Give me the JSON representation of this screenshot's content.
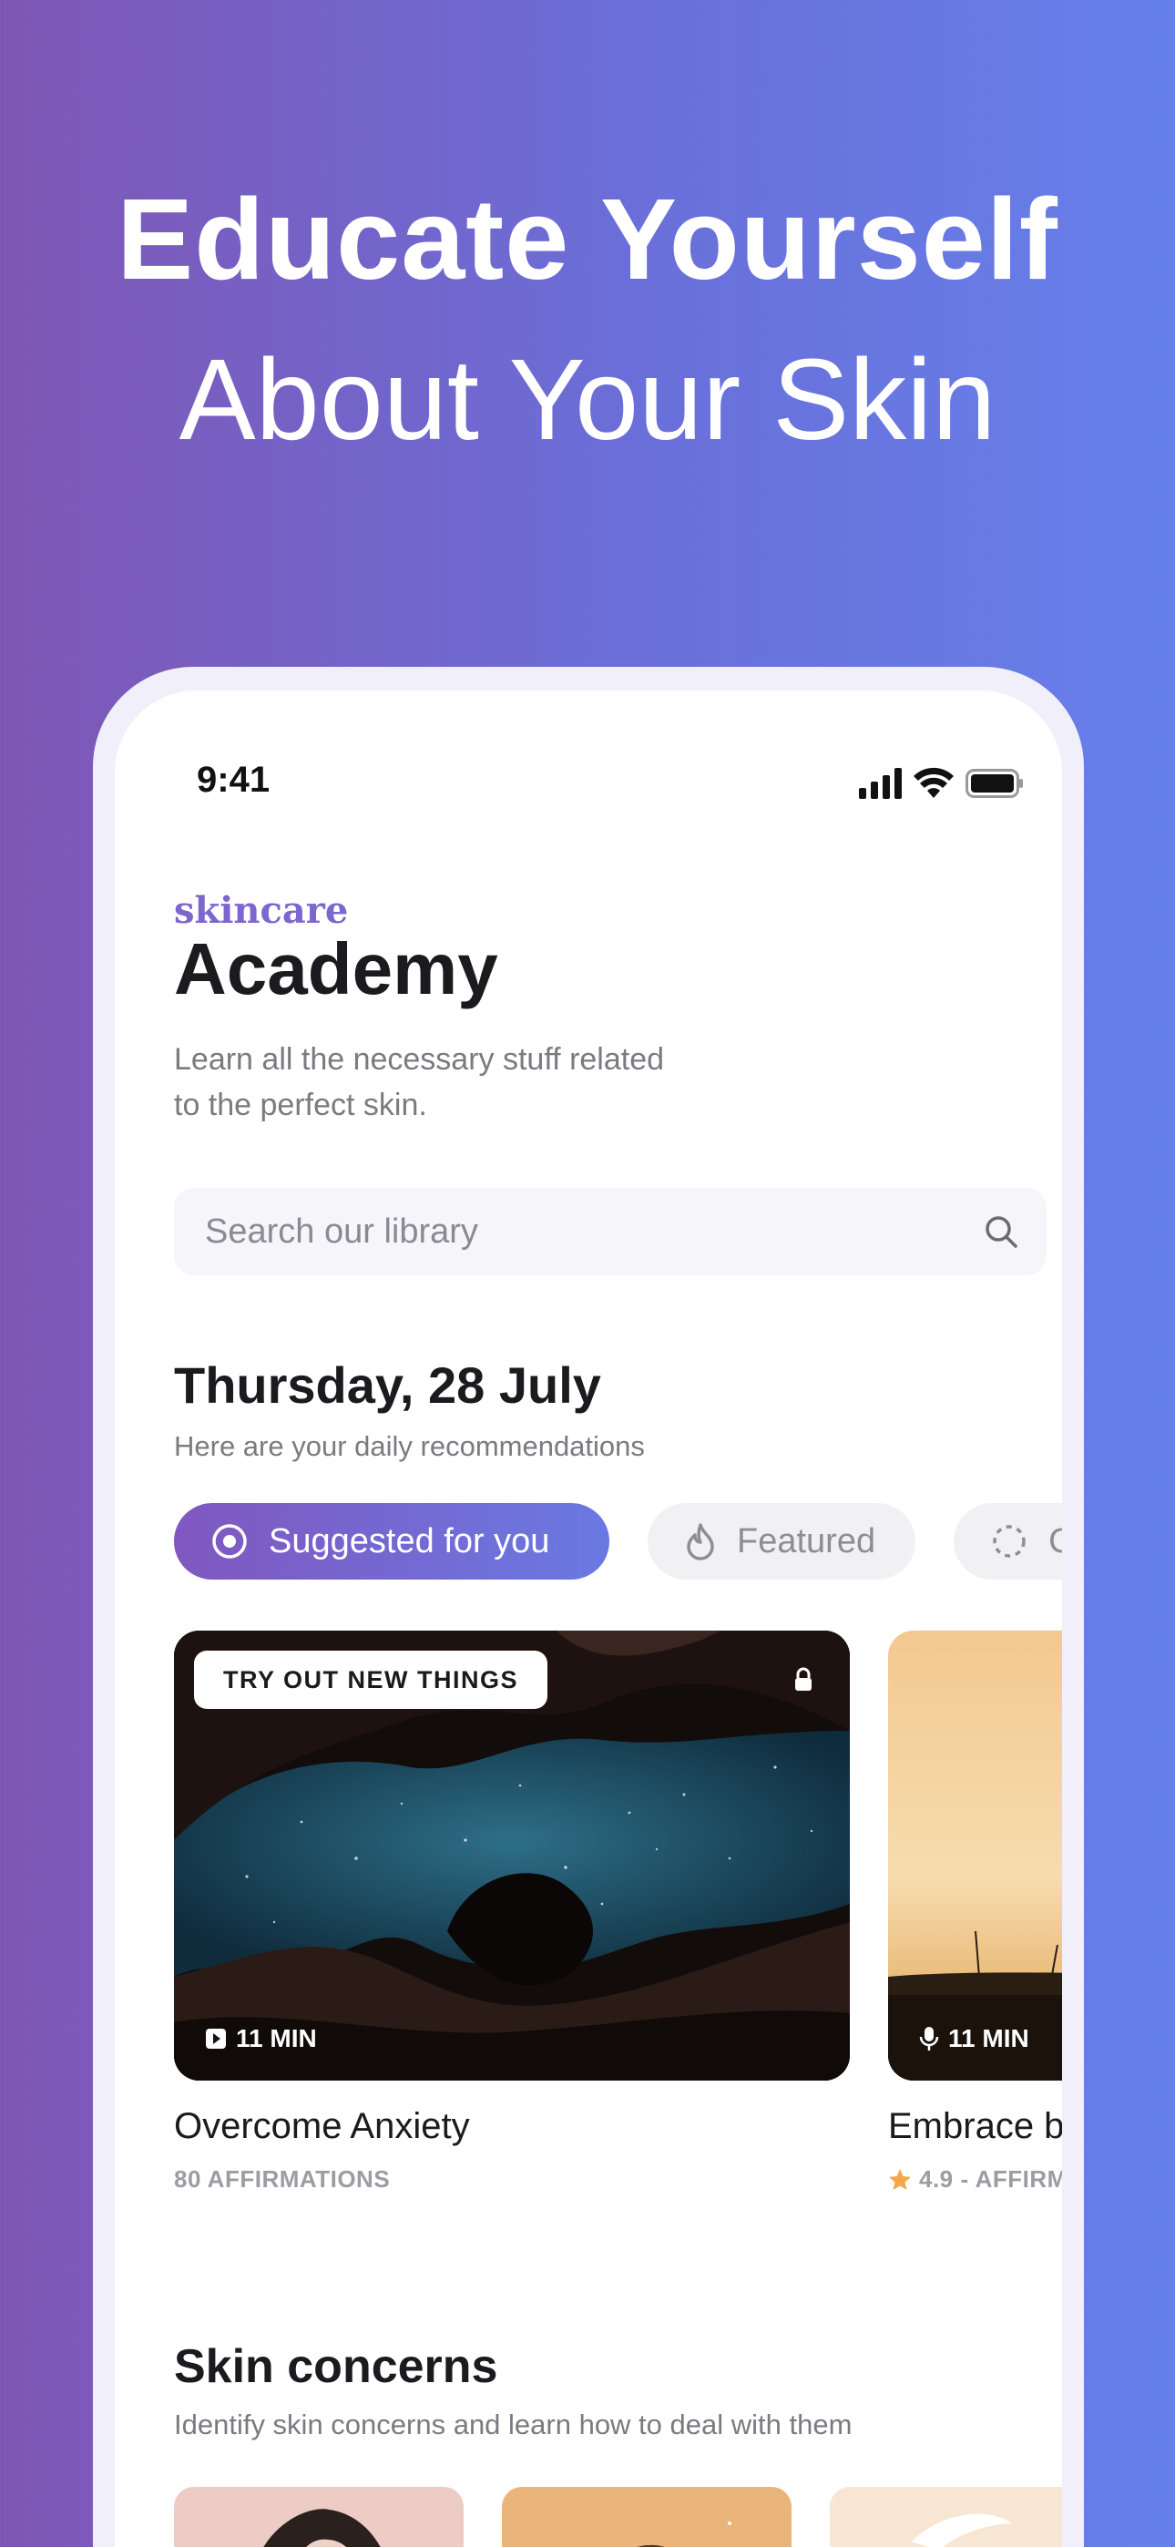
{
  "hero": {
    "title": "Educate Yourself",
    "subtitle": "About Your Skin"
  },
  "status_bar": {
    "time": "9:41",
    "icons": [
      "signal-icon",
      "wifi-icon",
      "battery-icon"
    ]
  },
  "header": {
    "brand": "skincare",
    "title": "Academy",
    "subtitle": "Learn all the necessary stuff related to the perfect skin."
  },
  "search": {
    "placeholder": "Search our library",
    "icon": "search-icon"
  },
  "daily": {
    "date": "Thursday, 28 July",
    "subtitle": "Here are your daily recommendations"
  },
  "chips": [
    {
      "label": "Suggested for you",
      "icon": "target-icon",
      "active": true
    },
    {
      "label": "Featured",
      "icon": "flame-icon",
      "active": false
    },
    {
      "label": "C",
      "icon": "loader-icon",
      "active": false
    }
  ],
  "cards": [
    {
      "tag": "TRY OUT NEW THINGS",
      "duration": "11 MIN",
      "media_icon": "video-icon",
      "locked": true,
      "title": "Overcome Anxiety",
      "meta": "80 AFFIRMATIONS"
    },
    {
      "duration": "11 MIN",
      "media_icon": "microphone-icon",
      "title": "Embrace be",
      "rating": "4.9",
      "meta": "- AFFIRMA"
    }
  ],
  "concerns": {
    "title": "Skin concerns",
    "subtitle": "Identify skin concerns and learn how to deal with them"
  },
  "colors": {
    "background_left": "#7f56b5",
    "background_right": "#6680ea",
    "brand": "#7c66cf",
    "chip_active_start": "#8057c0",
    "chip_active_end": "#6a79e2",
    "star": "#f2a94a"
  }
}
